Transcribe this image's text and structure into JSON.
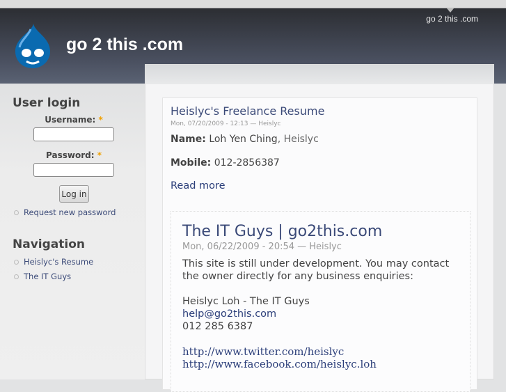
{
  "header": {
    "site_name": "go 2 this .com",
    "secondary_link": "go 2 this .com"
  },
  "sidebar": {
    "login": {
      "title": "User login",
      "username_label": "Username:",
      "password_label": "Password:",
      "required_mark": "*",
      "username_value": "",
      "password_value": "",
      "submit": "Log in",
      "links": [
        {
          "label": "Request new password"
        }
      ]
    },
    "navigation": {
      "title": "Navigation",
      "items": [
        {
          "label": "Heislyc's Resume"
        },
        {
          "label": "The IT Guys"
        }
      ]
    }
  },
  "nodes": [
    {
      "title": "Heislyc's Freelance Resume",
      "meta": "Mon, 07/20/2009 - 12:13 — Heislyc",
      "name_label": "Name:",
      "name_value": "Loh Yen Ching",
      "name_suffix": ", Heislyc",
      "mobile_label": "Mobile:",
      "mobile_value": "012-2856387",
      "read_more": "Read more"
    },
    {
      "title": "The IT Guys | go2this.com",
      "meta": "Mon, 06/22/2009 - 20:54 — Heislyc",
      "para": "This site is still under development. You may contact the owner directly for any business enquiries:",
      "contact_name": "Heislyc Loh - The IT Guys",
      "email": "help@go2this.com",
      "phone": "012 285 6387",
      "links": [
        "http://www.twitter.com/heislyc",
        "http://www.facebook.com/heislyc.loh"
      ]
    }
  ]
}
